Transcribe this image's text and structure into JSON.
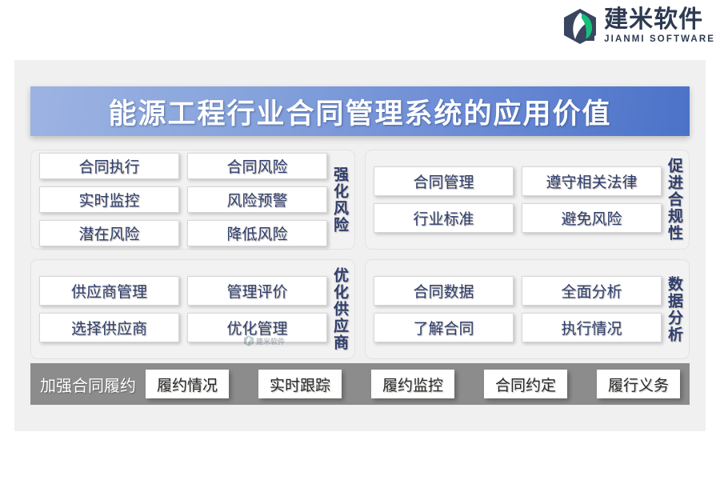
{
  "brand": {
    "logo_icon": "jianmi-hex-logo",
    "name_cn": "建米软件",
    "name_en": "JIANMI SOFTWARE",
    "colors": {
      "navy": "#2d3a52",
      "green": "#15c07a"
    }
  },
  "banner": {
    "title": "能源工程行业合同管理系统的应用价值",
    "gradient_from": "#9db3e2",
    "gradient_to": "#4a72c8",
    "text_color": "#ffffff"
  },
  "panels": [
    {
      "label": "强化风险",
      "col1": [
        "合同执行",
        "实时监控",
        "潜在风险"
      ],
      "col2": [
        "合同风险",
        "风险预警",
        "降低风险"
      ]
    },
    {
      "label": "促进合规性",
      "col1": [
        "合同管理",
        "行业标准"
      ],
      "col2": [
        "遵守相关法律",
        "避免风险"
      ]
    },
    {
      "label": "优化供应商",
      "col1": [
        "供应商管理",
        "选择供应商"
      ],
      "col2": [
        "管理评价",
        "优化管理"
      ]
    },
    {
      "label": "数据分析",
      "col1": [
        "合同数据",
        "了解合同"
      ],
      "col2": [
        "全面分析",
        "执行情况"
      ]
    }
  ],
  "bottom_bar": {
    "label": "加强合同履约",
    "background": "#8c8c8c",
    "items": [
      "履约情况",
      "实时跟踪",
      "履约监控",
      "合同约定",
      "履行义务"
    ]
  },
  "watermark": {
    "text": "建米软件"
  }
}
